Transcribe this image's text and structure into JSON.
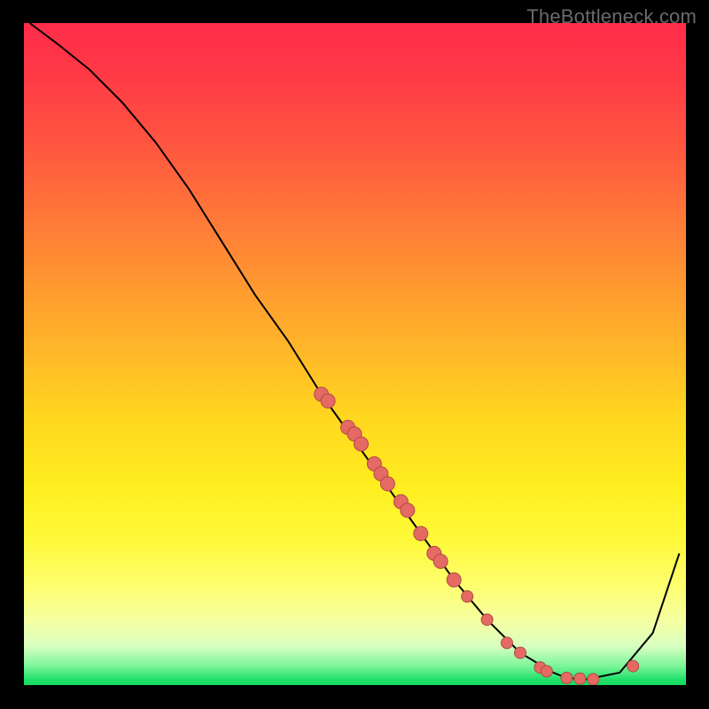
{
  "watermark": "TheBottleneck.com",
  "chart_data": {
    "type": "line",
    "title": "",
    "xlabel": "",
    "ylabel": "",
    "xlim": [
      0,
      100
    ],
    "ylim": [
      0,
      100
    ],
    "curve": {
      "x": [
        1,
        5,
        10,
        15,
        20,
        25,
        30,
        35,
        40,
        45,
        50,
        55,
        60,
        65,
        70,
        75,
        80,
        82,
        85,
        90,
        95,
        99
      ],
      "y": [
        100,
        97,
        93,
        88,
        82,
        75,
        67,
        59,
        52,
        44,
        37,
        30,
        23,
        16,
        10,
        5,
        2,
        1.2,
        1,
        2,
        8,
        20
      ]
    },
    "data_points": {
      "x": [
        45,
        46,
        49,
        50,
        51,
        53,
        54,
        55,
        57,
        58,
        60,
        62,
        63,
        65,
        67,
        70,
        73,
        75,
        78,
        79,
        82,
        84,
        86,
        92
      ],
      "y": [
        44,
        43,
        39,
        38,
        36.5,
        33.5,
        32,
        30.5,
        27.8,
        26.5,
        23,
        20,
        18.8,
        16,
        13.5,
        10,
        6.5,
        5,
        2.8,
        2.2,
        1.2,
        1.1,
        1.0,
        3
      ]
    },
    "gradient_stops": [
      {
        "offset": 0.0,
        "color": "#ff2c4a"
      },
      {
        "offset": 0.5,
        "color": "#ffd81f"
      },
      {
        "offset": 0.9,
        "color": "#f6ffa0"
      },
      {
        "offset": 1.0,
        "color": "#11d85d"
      }
    ]
  }
}
